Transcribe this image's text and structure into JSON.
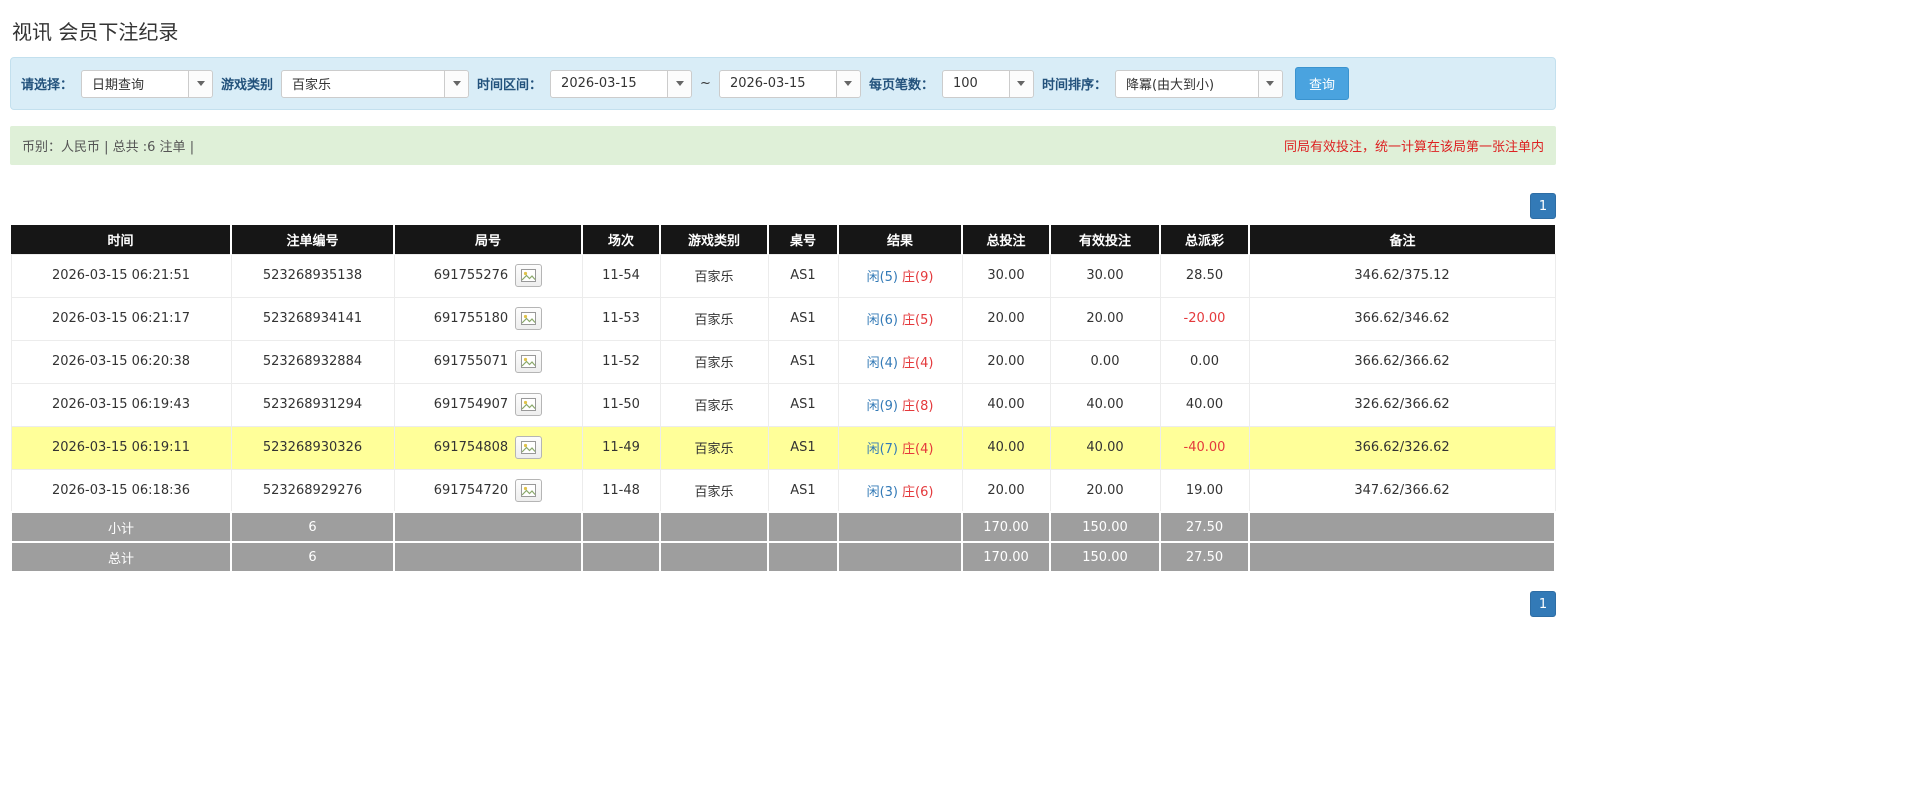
{
  "page": {
    "title": "视讯 会员下注纪录"
  },
  "filters": {
    "select_label": "请选择：",
    "select_value": "日期查询",
    "game_type_label": "游戏类别",
    "game_type_value": "百家乐",
    "time_range_label": "时间区间：",
    "date_from": "2026-03-15",
    "tilde": "~",
    "date_to": "2026-03-15",
    "page_size_label": "每页笔数：",
    "page_size_value": "100",
    "sort_label": "时间排序：",
    "sort_value": "降冪(由大到小)",
    "search_button": "查询"
  },
  "summary": {
    "left": "币别：人民币 | 总共 :6 注单 |",
    "right": "同局有效投注，统一计算在该局第一张注单内"
  },
  "pagination": {
    "page": "1"
  },
  "colors": {
    "link_blue": "#337ab7",
    "banker_red": "#e4393c",
    "negative_red": "#e4393c",
    "highlight_yellow": "#ffff99",
    "header_black": "#161616",
    "footer_gray": "#9e9e9e",
    "filter_bg": "#d9edf7",
    "summary_bg": "#dff0d8",
    "notice_red": "#dd2222",
    "search_button_blue": "#4aa3df",
    "pagination_blue": "#337ab7"
  },
  "table": {
    "headers": [
      "时间",
      "注单编号",
      "局号",
      "场次",
      "游戏类别",
      "桌号",
      "结果",
      "总投注",
      "有效投注",
      "总派彩",
      "备注"
    ],
    "rows": [
      {
        "time": "2026-03-15 06:21:51",
        "bet_id": "523268935138",
        "round": "691755276",
        "session": "11-54",
        "game": "百家乐",
        "table_no": "AS1",
        "result_player": "闲(5)",
        "result_banker": "庄(9)",
        "total_bet": "30.00",
        "valid_bet": "30.00",
        "payout": "28.50",
        "note": "346.62/375.12",
        "highlight": false
      },
      {
        "time": "2026-03-15 06:21:17",
        "bet_id": "523268934141",
        "round": "691755180",
        "session": "11-53",
        "game": "百家乐",
        "table_no": "AS1",
        "result_player": "闲(6)",
        "result_banker": "庄(5)",
        "total_bet": "20.00",
        "valid_bet": "20.00",
        "payout": "-20.00",
        "note": "366.62/346.62",
        "highlight": false
      },
      {
        "time": "2026-03-15 06:20:38",
        "bet_id": "523268932884",
        "round": "691755071",
        "session": "11-52",
        "game": "百家乐",
        "table_no": "AS1",
        "result_player": "闲(4)",
        "result_banker": "庄(4)",
        "total_bet": "20.00",
        "valid_bet": "0.00",
        "payout": "0.00",
        "note": "366.62/366.62",
        "highlight": false
      },
      {
        "time": "2026-03-15 06:19:43",
        "bet_id": "523268931294",
        "round": "691754907",
        "session": "11-50",
        "game": "百家乐",
        "table_no": "AS1",
        "result_player": "闲(9)",
        "result_banker": "庄(8)",
        "total_bet": "40.00",
        "valid_bet": "40.00",
        "payout": "40.00",
        "note": "326.62/366.62",
        "highlight": false
      },
      {
        "time": "2026-03-15 06:19:11",
        "bet_id": "523268930326",
        "round": "691754808",
        "session": "11-49",
        "game": "百家乐",
        "table_no": "AS1",
        "result_player": "闲(7)",
        "result_banker": "庄(4)",
        "total_bet": "40.00",
        "valid_bet": "40.00",
        "payout": "-40.00",
        "note": "366.62/326.62",
        "highlight": true
      },
      {
        "time": "2026-03-15 06:18:36",
        "bet_id": "523268929276",
        "round": "691754720",
        "session": "11-48",
        "game": "百家乐",
        "table_no": "AS1",
        "result_player": "闲(3)",
        "result_banker": "庄(6)",
        "total_bet": "20.00",
        "valid_bet": "20.00",
        "payout": "19.00",
        "note": "347.62/366.62",
        "highlight": false
      }
    ],
    "subtotal": {
      "label": "小计",
      "count": "6",
      "total_bet": "170.00",
      "valid_bet": "150.00",
      "payout": "27.50"
    },
    "total": {
      "label": "总计",
      "count": "6",
      "total_bet": "170.00",
      "valid_bet": "150.00",
      "payout": "27.50"
    }
  }
}
